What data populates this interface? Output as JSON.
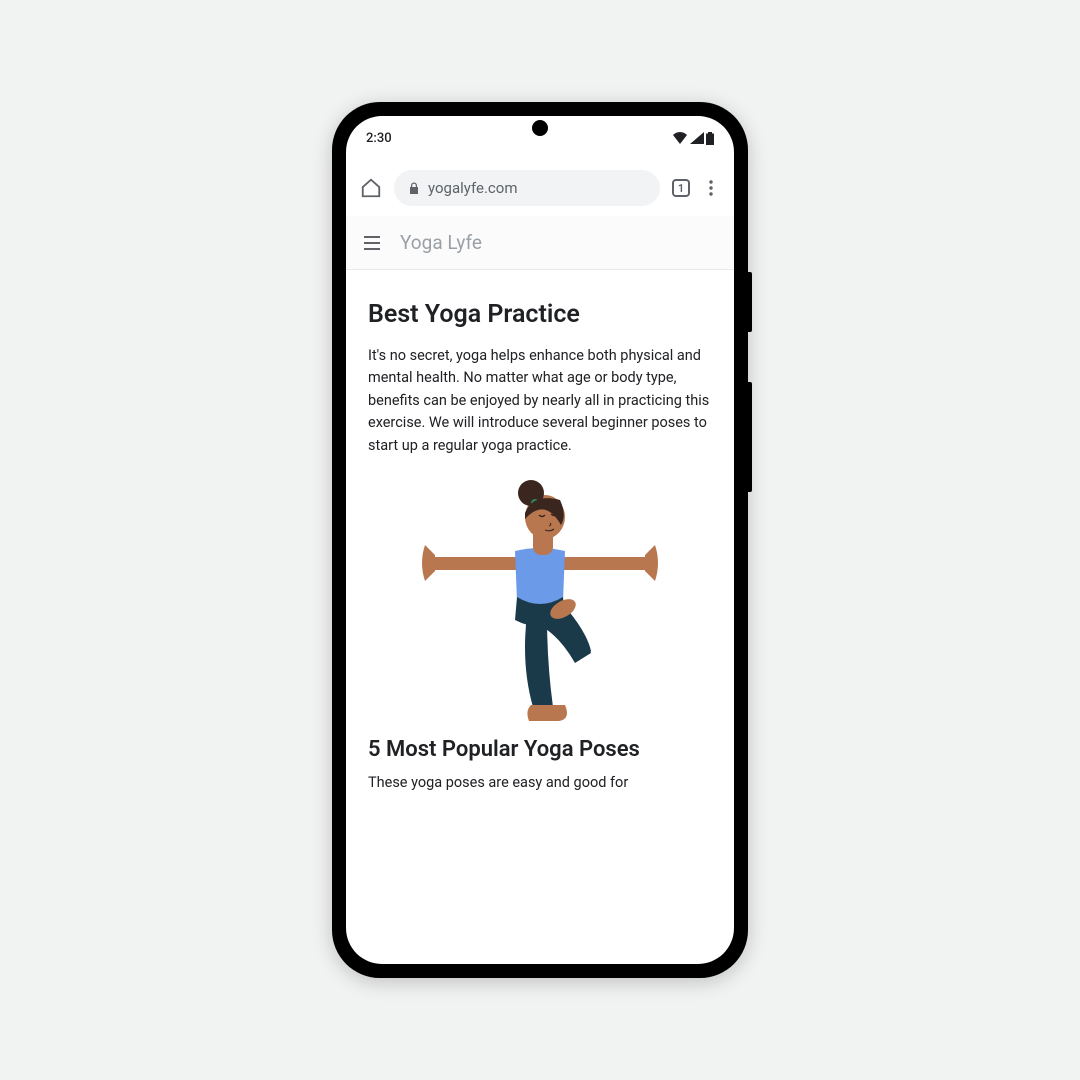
{
  "status_bar": {
    "time": "2:30"
  },
  "browser": {
    "url": "yogalyfe.com",
    "tab_count": "1"
  },
  "site": {
    "title": "Yoga Lyfe"
  },
  "article": {
    "title": "Best Yoga Practice",
    "body": "It's no secret, yoga helps enhance both physical and mental health. No matter what age or body type, benefits can be enjoyed by nearly all in practicing this exercise. We will introduce several beginner poses  to start up a regular yoga practice."
  },
  "section": {
    "title": "5 Most Popular Yoga Poses",
    "body": "These yoga poses are easy and good for"
  }
}
